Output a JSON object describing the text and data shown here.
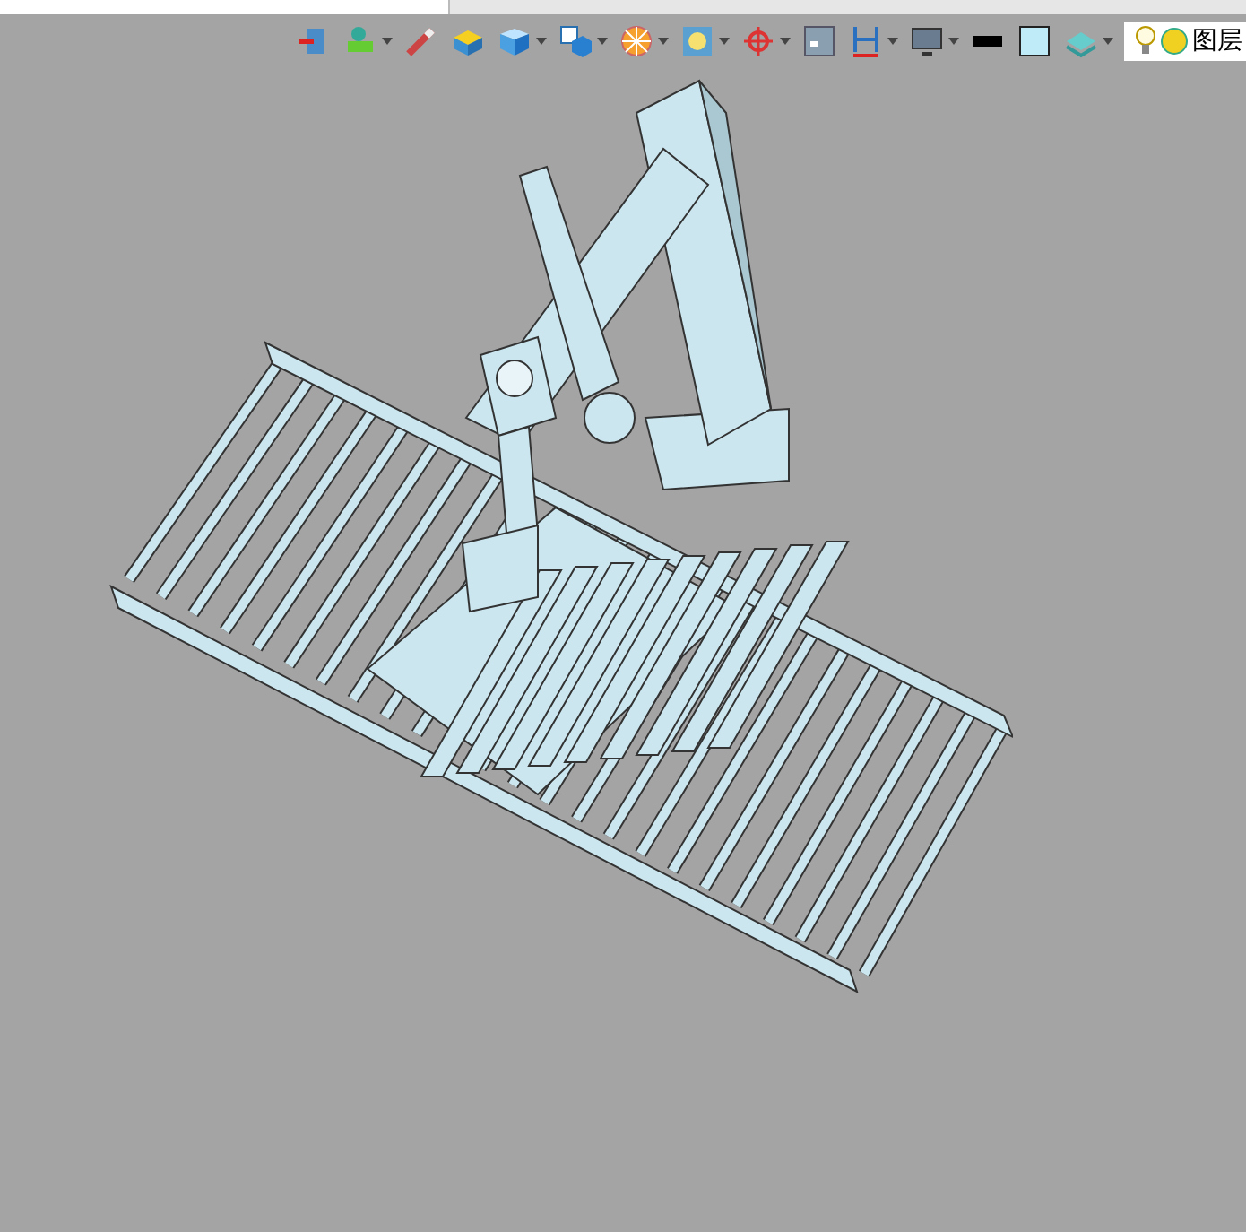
{
  "toolbar": {
    "tools": [
      {
        "has_menu": false
      },
      {
        "has_menu": true
      },
      {
        "has_menu": false
      },
      {
        "has_menu": false
      },
      {
        "has_menu": true
      },
      {
        "has_menu": true
      },
      {
        "has_menu": true
      },
      {
        "has_menu": true
      },
      {
        "has_menu": true
      },
      {
        "has_menu": false
      },
      {
        "has_menu": true
      },
      {
        "has_menu": true
      },
      {
        "has_menu": false
      },
      {
        "has_menu": false
      },
      {
        "has_menu": true
      }
    ],
    "layer_field": {
      "value": "图层"
    }
  }
}
